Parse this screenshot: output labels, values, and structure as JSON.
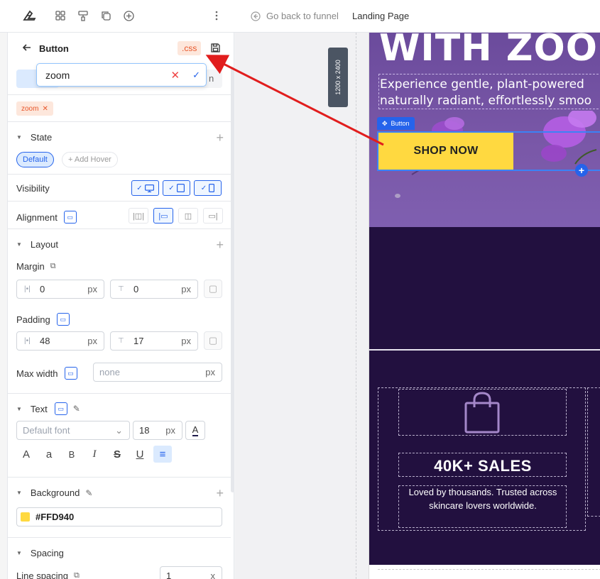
{
  "topbar": {
    "icons": [
      "logo-icon",
      "grid-icon",
      "paint-roller-icon",
      "copy-icon",
      "add-circle-icon",
      "more-vertical-icon"
    ],
    "back_label": "Go back to funnel",
    "page_title": "Landing Page"
  },
  "panel": {
    "header_title": "Button",
    "css_badge": ".css",
    "search": {
      "value": "zoom"
    },
    "tab_hint_right": "n",
    "chip_label": "zoom",
    "state": {
      "title": "State",
      "default_label": "Default",
      "add_hover_label": "+ Add Hover"
    },
    "visibility": {
      "label": "Visibility"
    },
    "alignment": {
      "label": "Alignment"
    },
    "layout": {
      "title": "Layout",
      "margin_label": "Margin",
      "margin_x": "0",
      "margin_y": "0",
      "padding_label": "Padding",
      "padding_x": "48",
      "padding_y": "17",
      "unit": "px",
      "max_width_label": "Max width",
      "max_width_placeholder": "none"
    },
    "text": {
      "title": "Text",
      "font_placeholder": "Default font",
      "font_size": "18",
      "color_glyph": "A",
      "format_glyphs": [
        "A",
        "a",
        "B",
        "I",
        "S",
        "U",
        "≡"
      ]
    },
    "background": {
      "title": "Background",
      "color": "#FFD940",
      "color_label": "#FFD940"
    },
    "spacing": {
      "title": "Spacing",
      "line_spacing_label": "Line spacing",
      "line_spacing_value": "1",
      "line_spacing_unit": "x"
    }
  },
  "canvas": {
    "ruler_label": "1200 x 2400",
    "hero_heading": "WITH ZOO",
    "hero_sub": "Experience gentle, plant-powered\nnaturally radiant, effortlessly smoo",
    "button_tag": "Button",
    "button_text": "SHOP NOW",
    "stat_title": "40K+ SALES",
    "stat_desc": "Loved by thousands. Trusted across skincare lovers worldwide."
  },
  "colors": {
    "accent": "#2563eb",
    "button_bg": "#FFD940",
    "hero_bg": "#6b4b9c",
    "dark_section": "#22103f",
    "annotation_red": "#e11d1d"
  }
}
